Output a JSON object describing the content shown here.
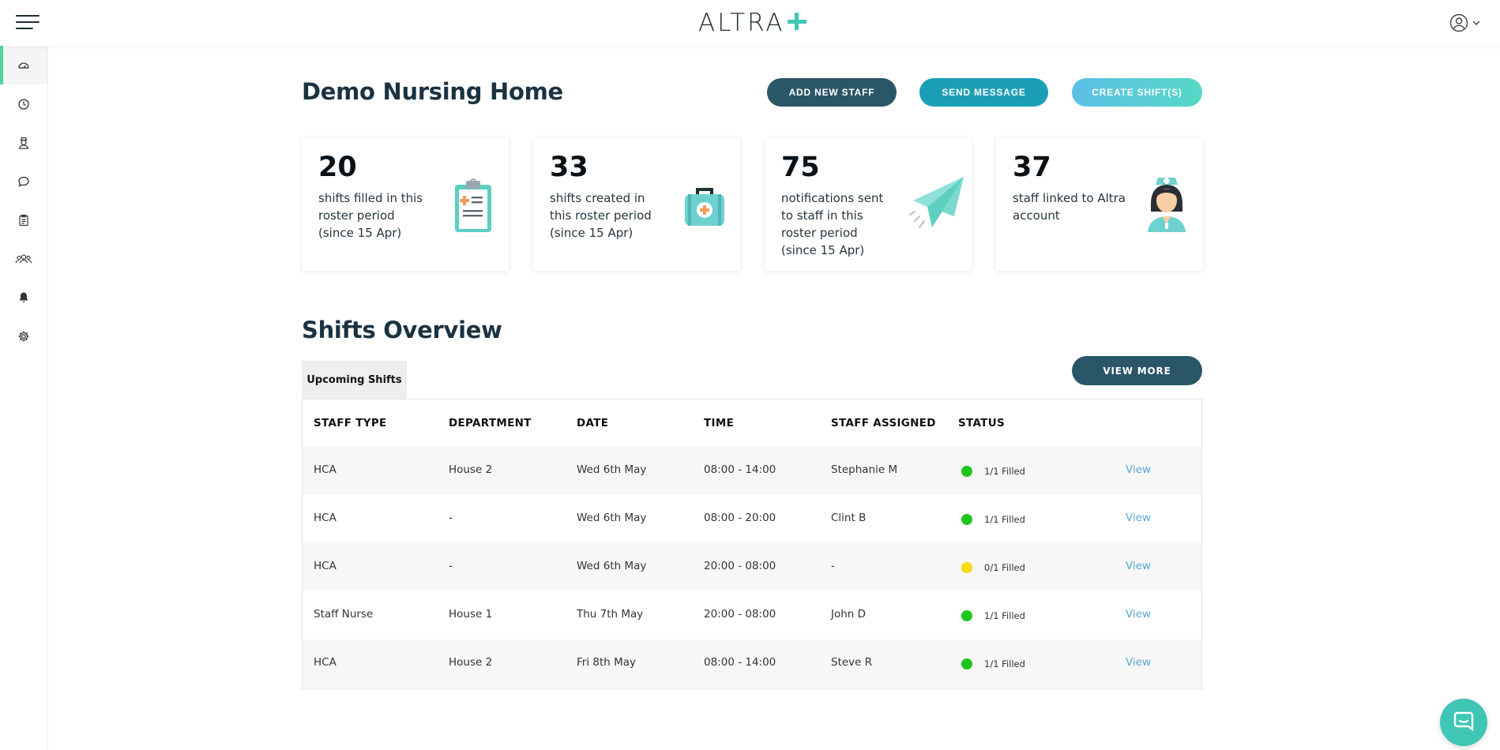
{
  "app": {
    "logo_text": "ALTRA",
    "accent_color": "#3fc6b5",
    "brand_dark": "#2a5668"
  },
  "sidebar": {
    "items": [
      {
        "name": "dashboard",
        "icon": "dashboard-gauge-icon",
        "active": true
      },
      {
        "name": "timesheets",
        "icon": "clock-icon",
        "active": false
      },
      {
        "name": "staff",
        "icon": "nurse-icon",
        "active": false
      },
      {
        "name": "messages",
        "icon": "chat-icon",
        "active": false
      },
      {
        "name": "shifts",
        "icon": "clipboard-icon",
        "active": false
      },
      {
        "name": "teams",
        "icon": "group-icon",
        "active": false
      },
      {
        "name": "notifications",
        "icon": "bell-icon",
        "active": false
      },
      {
        "name": "settings",
        "icon": "gear-icon",
        "active": false
      }
    ]
  },
  "header": {
    "title": "Demo Nursing Home",
    "buttons": {
      "add_staff": "ADD NEW STAFF",
      "send_message": "SEND MESSAGE",
      "create_shifts": "CREATE SHIFT(S)"
    }
  },
  "stats": [
    {
      "value": "20",
      "text": "shifts filled in this roster period (since 15 Apr)",
      "icon": "clipboard-medical-icon"
    },
    {
      "value": "33",
      "text": "shifts created in this roster period (since 15 Apr)",
      "icon": "medical-kit-icon"
    },
    {
      "value": "75",
      "text": "notifications sent to staff in this roster period (since 15 Apr)",
      "icon": "paper-plane-icon"
    },
    {
      "value": "37",
      "text": "staff linked to Altra account",
      "icon": "nurse-avatar-icon"
    }
  ],
  "overview": {
    "title": "Shifts Overview",
    "view_more": "VIEW MORE",
    "tab": "Upcoming Shifts",
    "columns": [
      "STAFF TYPE",
      "DEPARTMENT",
      "DATE",
      "TIME",
      "STAFF ASSIGNED",
      "STATUS"
    ],
    "rows": [
      {
        "staff_type": "HCA",
        "department": "House 2",
        "date": "Wed 6th May",
        "time": "08:00 - 14:00",
        "staff": "Stephanie M",
        "status": "1/1 Filled",
        "status_color": "#1dc51d",
        "action": "View"
      },
      {
        "staff_type": "HCA",
        "department": "-",
        "date": "Wed 6th May",
        "time": "08:00 - 20:00",
        "staff": "Clint B",
        "status": "1/1 Filled",
        "status_color": "#1dc51d",
        "action": "View"
      },
      {
        "staff_type": "HCA",
        "department": "-",
        "date": "Wed 6th May",
        "time": "20:00 - 08:00",
        "staff": "-",
        "status": "0/1 Filled",
        "status_color": "#f5dc12",
        "action": "View"
      },
      {
        "staff_type": "Staff Nurse",
        "department": "House 1",
        "date": "Thu 7th May",
        "time": "20:00 - 08:00",
        "staff": "John D",
        "status": "1/1 Filled",
        "status_color": "#1dc51d",
        "action": "View"
      },
      {
        "staff_type": "HCA",
        "department": "House 2",
        "date": "Fri 8th May",
        "time": "08:00 - 14:00",
        "staff": "Steve R",
        "status": "1/1 Filled",
        "status_color": "#1dc51d",
        "action": "View"
      }
    ]
  }
}
